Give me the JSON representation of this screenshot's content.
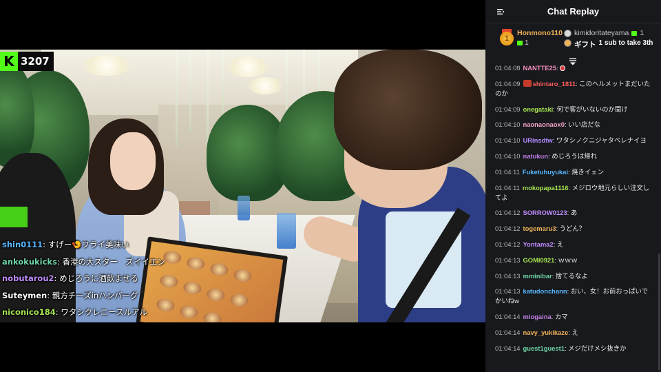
{
  "viewer_badge": {
    "logo": "K",
    "count": "3207"
  },
  "overlay_comments": [
    {
      "user": "shin0111",
      "text": "すげー🍤フライ美味い",
      "color": "#58b7ff"
    },
    {
      "user": "ankokukicks",
      "text": "香港の大スター　ズイイエン",
      "color": "#6fd3a8"
    },
    {
      "user": "nobutarou2",
      "text": "めじろうに酒飲ませる",
      "color": "#c08cff"
    },
    {
      "user": "Suteymen",
      "text": "親方チーズinハンバーグ",
      "color": "#ffffff"
    },
    {
      "user": "niconico184",
      "text": "ワタシクレニースルアル",
      "color": "#a5e34f"
    }
  ],
  "chat": {
    "title": "Chat Replay",
    "top_gifter": {
      "rank": "1",
      "name": "Honmono110",
      "count": "1"
    },
    "gift_event": {
      "name": "kimidoritateyama",
      "count": "1",
      "label": "ギフト",
      "text": "1 sub to take 3th"
    },
    "messages": [
      {
        "time": "01:04:08",
        "user": "NANTTE25",
        "text": "",
        "color": "#f68fc1",
        "emote": true
      },
      {
        "time": "01:04:09",
        "user": "shintaro_1811",
        "text": "このヘルメットまだいたのか",
        "color": "#ff5c5c",
        "badge": true
      },
      {
        "time": "01:04:09",
        "user": "onegataki",
        "text": "何で客がいないのか聞け",
        "color": "#a5e34f"
      },
      {
        "time": "01:04:10",
        "user": "naonaonaox0",
        "text": "いい店だな",
        "color": "#f4a3c9"
      },
      {
        "time": "01:04:10",
        "user": "URinsdtw",
        "text": "ワタシノクニジャタベレナイヨ",
        "color": "#b18cff"
      },
      {
        "time": "01:04:10",
        "user": "natukun",
        "text": "めじろうは帰れ",
        "color": "#c07fe8"
      },
      {
        "time": "01:04:11",
        "user": "Fuketuhuyukai",
        "text": "焼きイェン",
        "color": "#58b7ff"
      },
      {
        "time": "01:04:11",
        "user": "mokopapa1116",
        "text": "メジロウ地元らしい注文してよ",
        "color": "#a5e34f"
      },
      {
        "time": "01:04:12",
        "user": "SORROW0123",
        "text": "あ",
        "color": "#c08cff"
      },
      {
        "time": "01:04:12",
        "user": "togemaru3",
        "text": "うどん？",
        "color": "#f0b35a"
      },
      {
        "time": "01:04:12",
        "user": "Yontama2",
        "text": "え",
        "color": "#c08cff"
      },
      {
        "time": "01:04:13",
        "user": "GOMI0921",
        "text": "ｗｗｗ",
        "color": "#a5e34f"
      },
      {
        "time": "01:04:13",
        "user": "mminibar",
        "text": "捨てるなよ",
        "color": "#6fd3a8"
      },
      {
        "time": "01:04:13",
        "user": "katudonchann",
        "text": "おい、女！お前おっぱいでかいねw",
        "color": "#58b7ff"
      },
      {
        "time": "01:04:14",
        "user": "miogaina",
        "text": "カマ",
        "color": "#c07fe8"
      },
      {
        "time": "01:04:14",
        "user": "navy_yukikaze",
        "text": "え",
        "color": "#f0b35a"
      },
      {
        "time": "01:04:14",
        "user": "guest1guest1",
        "text": "メジだけメシ抜きか",
        "color": "#6fd3a8"
      }
    ]
  },
  "colors": {
    "brand": "#53fc18",
    "panel_bg": "#18191c",
    "gifter_name": "#f0b35a"
  }
}
